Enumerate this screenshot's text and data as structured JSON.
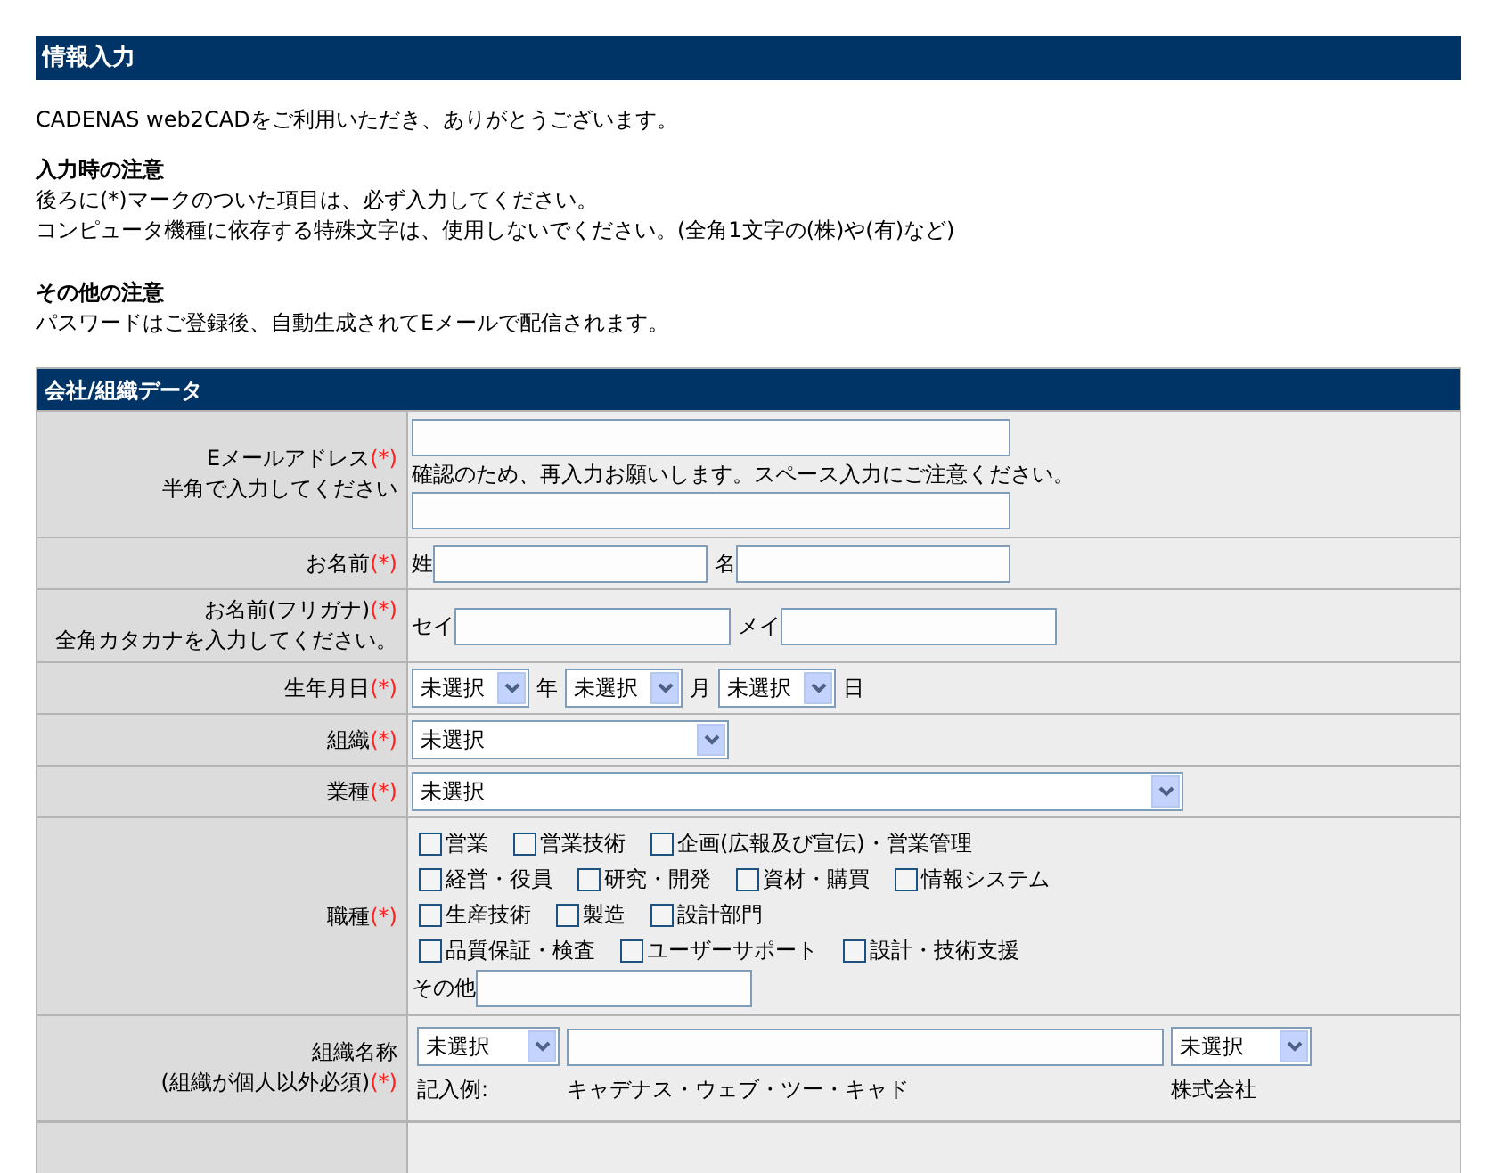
{
  "page_title": "情報入力",
  "intro": "CADENAS web2CADをご利用いただき、ありがとうございます。",
  "notes": [
    {
      "heading": "入力時の注意",
      "lines": [
        "後ろに(*)マークのついた項目は、必ず入力してください。",
        "コンピュータ機種に依存する特殊文字は、使用しないでください。(全角1文字の(株)や(有)など)"
      ]
    },
    {
      "heading": "その他の注意",
      "lines": [
        "パスワードはご登録後、自動生成されてEメールで配信されます。"
      ]
    }
  ],
  "section": {
    "title": "会社/組織データ",
    "rows": [
      {
        "kind": "email",
        "label": [
          {
            "text": "Eメールアドレス",
            "mark": "(*)"
          },
          {
            "text": "半角で入力してください"
          }
        ],
        "note": "確認のため、再入力お願いします。スペース入力にご注意ください。"
      },
      {
        "kind": "pair",
        "label": [
          {
            "text": "お名前",
            "mark": "(*)"
          }
        ],
        "parts": [
          {
            "label": "姓"
          },
          {
            "label": "名"
          }
        ]
      },
      {
        "kind": "pair",
        "label": [
          {
            "text": "お名前(フリガナ)",
            "mark": "(*)"
          },
          {
            "text": "全角カタカナを入力してください。"
          }
        ],
        "parts": [
          {
            "label": "セイ"
          },
          {
            "label": "メイ"
          }
        ]
      },
      {
        "kind": "date",
        "label": [
          {
            "text": "生年月日",
            "mark": "(*)"
          }
        ],
        "parts": [
          {
            "value": "未選択",
            "unit": "年"
          },
          {
            "value": "未選択",
            "unit": "月"
          },
          {
            "value": "未選択",
            "unit": "日"
          }
        ]
      },
      {
        "kind": "select_medium",
        "label": [
          {
            "text": "組織",
            "mark": "(*)"
          }
        ],
        "value": "未選択"
      },
      {
        "kind": "select_wide",
        "label": [
          {
            "text": "業種",
            "mark": "(*)"
          }
        ],
        "value": "未選択"
      },
      {
        "kind": "checkboxes",
        "label": [
          {
            "text": "職種",
            "mark": "(*)"
          }
        ],
        "lines": [
          [
            {
              "label": "営業",
              "checked": false
            },
            {
              "label": "営業技術",
              "checked": false
            },
            {
              "label": "企画(広報及び宣伝)・営業管理",
              "checked": false
            }
          ],
          [
            {
              "label": "経営・役員",
              "checked": false
            },
            {
              "label": "研究・開発",
              "checked": false
            },
            {
              "label": "資材・購買",
              "checked": false
            },
            {
              "label": "情報システム",
              "checked": false
            }
          ],
          [
            {
              "label": "生産技術",
              "checked": false
            },
            {
              "label": "製造",
              "checked": false
            },
            {
              "label": "設計部門",
              "checked": false
            }
          ],
          [
            {
              "label": "品質保証・検査",
              "checked": false
            },
            {
              "label": "ユーザーサポート",
              "checked": false
            },
            {
              "label": "設計・技術支援",
              "checked": false
            }
          ]
        ],
        "other_label": "その他"
      },
      {
        "kind": "company",
        "label": [
          {
            "text": "組織名称"
          },
          {
            "text": "(組織が個人以外必須)",
            "mark": "(*)"
          }
        ],
        "prefix": "未選択",
        "suffix": "未選択",
        "example_label": "記入例:",
        "example_name": "キャデナス・ウェブ・ツー・キャド",
        "example_suffix": "株式会社"
      }
    ]
  }
}
